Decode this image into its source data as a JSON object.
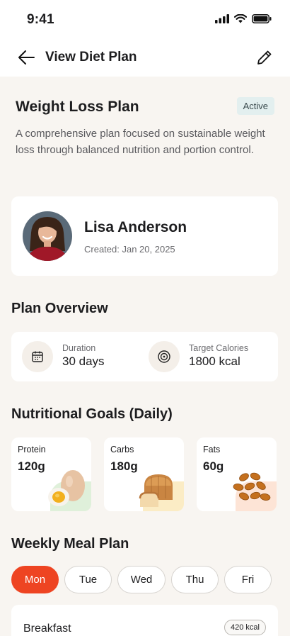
{
  "status_bar": {
    "time": "9:41"
  },
  "header": {
    "title": "View Diet Plan"
  },
  "plan": {
    "title": "Weight Loss Plan",
    "status": "Active",
    "description": "A comprehensive plan focused on sustainable weight loss through balanced nutrition and portion control."
  },
  "client": {
    "name": "Lisa Anderson",
    "created": "Created: Jan 20, 2025"
  },
  "overview": {
    "title": "Plan Overview",
    "duration_label": "Duration",
    "duration_value": "30 days",
    "calories_label": "Target Calories",
    "calories_value": "1800 kcal"
  },
  "goals": {
    "title": "Nutritional Goals (Daily)",
    "items": [
      {
        "label": "Protein",
        "value": "120g",
        "icon": "egg-icon",
        "color": "#dff0da"
      },
      {
        "label": "Carbs",
        "value": "180g",
        "icon": "bread-icon",
        "color": "#fbecc5"
      },
      {
        "label": "Fats",
        "value": "60g",
        "icon": "almond-icon",
        "color": "#fde4d6"
      }
    ]
  },
  "weekly": {
    "title": "Weekly Meal Plan",
    "days": [
      "Mon",
      "Tue",
      "Wed",
      "Thu",
      "Fri"
    ],
    "selected_day": "Mon"
  },
  "meal": {
    "name": "Breakfast",
    "calories": "420 kcal"
  },
  "colors": {
    "accent": "#ee4422",
    "background": "#f8f5f1",
    "active_badge": "#e3efef"
  }
}
